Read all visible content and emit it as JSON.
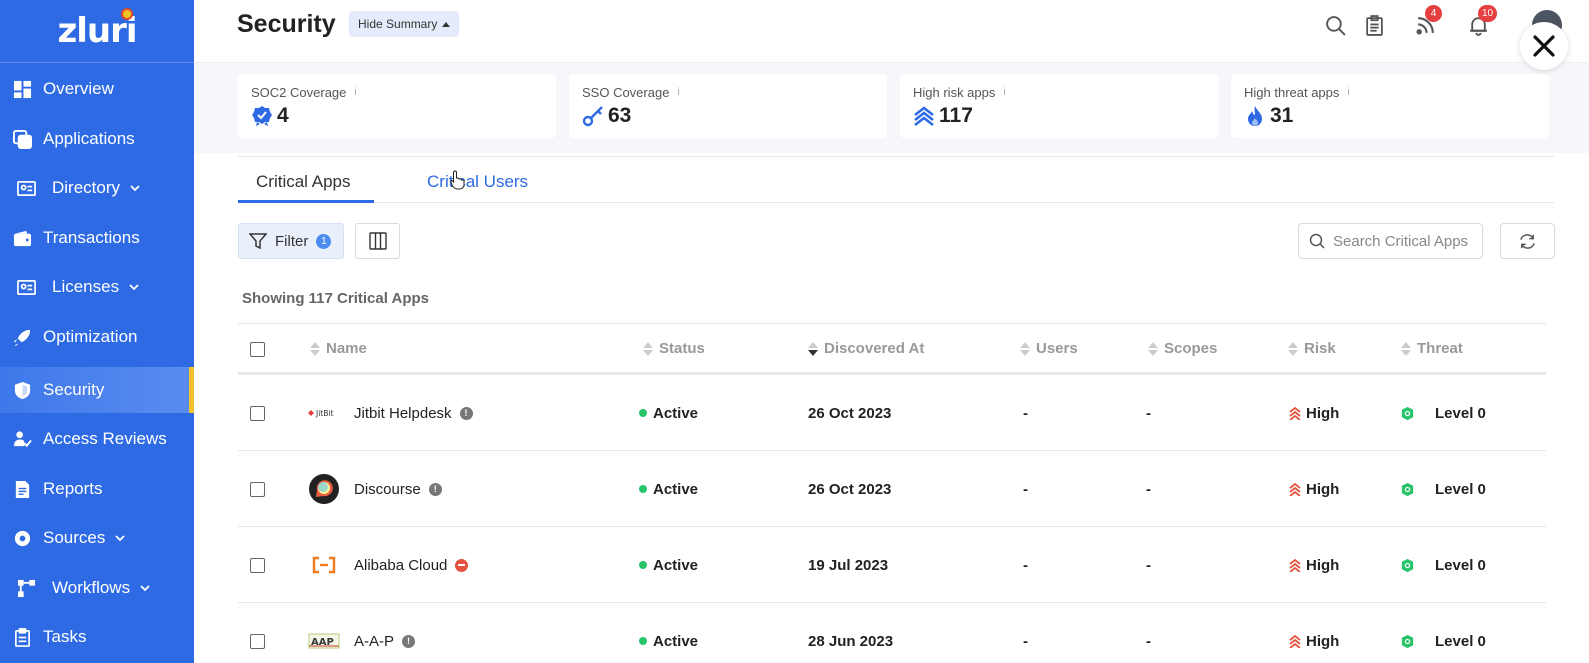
{
  "sidebar": {
    "logo_text": "zluri",
    "items": [
      {
        "label": "Overview"
      },
      {
        "label": "Applications"
      },
      {
        "label": "Directory"
      },
      {
        "label": "Transactions"
      },
      {
        "label": "Licenses"
      },
      {
        "label": "Optimization"
      },
      {
        "label": "Security"
      },
      {
        "label": "Access Reviews"
      },
      {
        "label": "Reports"
      },
      {
        "label": "Sources"
      },
      {
        "label": "Workflows"
      },
      {
        "label": "Tasks"
      }
    ],
    "active_index": 6,
    "bg_color": "#2d6ae3",
    "active_marker_color": "#f2c12b"
  },
  "header": {
    "title": "Security",
    "hide_summary_label": "Hide Summary",
    "feed_badge": "4",
    "notification_badge": "10"
  },
  "summary": {
    "cards": [
      {
        "label": "SOC2 Coverage",
        "value": "4",
        "icon": "badge-check-icon"
      },
      {
        "label": "SSO Coverage",
        "value": "63",
        "icon": "key-icon"
      },
      {
        "label": "High risk apps",
        "value": "117",
        "icon": "chevrons-up-icon"
      },
      {
        "label": "High threat apps",
        "value": "31",
        "icon": "flame-icon"
      }
    ],
    "info_glyph": "i"
  },
  "tabs": [
    {
      "label": "Critical Apps",
      "active": true
    },
    {
      "label": "Critical Users",
      "active": false
    }
  ],
  "toolbar": {
    "filter_label": "Filter",
    "filter_count": "1",
    "search_placeholder": "Search Critical Apps"
  },
  "showing_text": "Showing 117 Critical Apps",
  "table": {
    "columns": [
      "Name",
      "Status",
      "Discovered At",
      "Users",
      "Scopes",
      "Risk",
      "Threat"
    ],
    "rows": [
      {
        "name": "Jitbit Helpdesk",
        "status": "Active",
        "discovered": "26 Oct 2023",
        "users": "-",
        "scopes": "-",
        "risk": "High",
        "threat": "Level 0",
        "logo_text": "JitBit"
      },
      {
        "name": "Discourse",
        "status": "Active",
        "discovered": "26 Oct 2023",
        "users": "-",
        "scopes": "-",
        "risk": "High",
        "threat": "Level 0",
        "logo_text": ""
      },
      {
        "name": "Alibaba Cloud",
        "status": "Active",
        "discovered": "19 Jul 2023",
        "users": "-",
        "scopes": "-",
        "risk": "High",
        "threat": "Level 0",
        "logo_text": ""
      },
      {
        "name": "A-A-P",
        "status": "Active",
        "discovered": "28 Jun 2023",
        "users": "-",
        "scopes": "-",
        "risk": "High",
        "threat": "Level 0",
        "logo_text": "AAP"
      }
    ]
  },
  "colors": {
    "accent": "#2d6ae3",
    "status_active": "#27c46a",
    "risk_high": "#e5533f",
    "threat_level0": "#27c46a"
  }
}
